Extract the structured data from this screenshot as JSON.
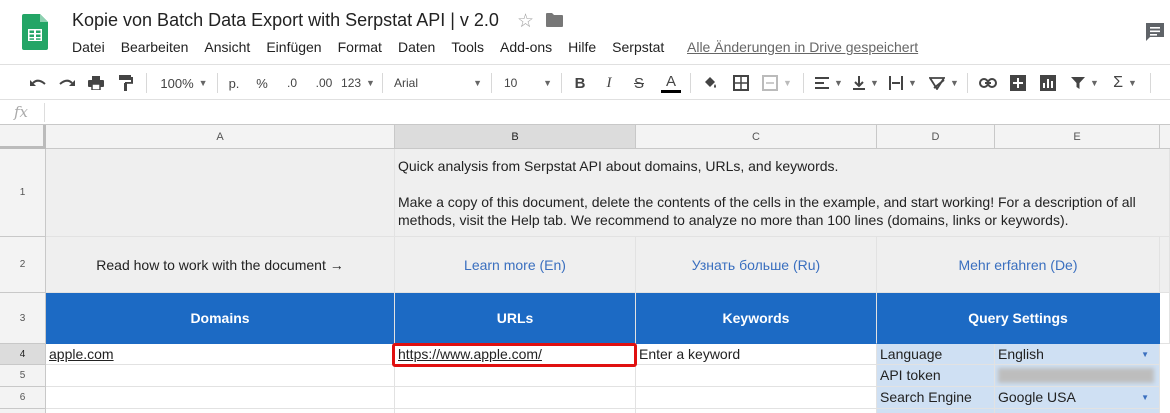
{
  "app": {
    "doc_title": "Kopie von Batch Data Export with Serpstat API |  v 2.0",
    "menu": [
      "Datei",
      "Bearbeiten",
      "Ansicht",
      "Einfügen",
      "Format",
      "Daten",
      "Tools",
      "Add-ons",
      "Hilfe",
      "Serpstat"
    ],
    "saved_status": "Alle Änderungen in Drive gespeichert"
  },
  "toolbar": {
    "zoom": "100%",
    "currency": "p.",
    "percent": "%",
    "dec_decrease": ".0",
    "dec_increase": ".00",
    "more_formats": "123",
    "font": "Arial",
    "font_size": "10"
  },
  "formula_bar": {
    "fx": "fx",
    "value": ""
  },
  "columns": [
    "A",
    "B",
    "C",
    "D",
    "E"
  ],
  "rows": [
    "1",
    "2",
    "3",
    "4",
    "5",
    "6"
  ],
  "cells": {
    "b1_line1": "Quick analysis from Serpstat API about domains, URLs, and keywords.",
    "b1_line2": "Make a copy of this document, delete the contents of the cells in the example, and start working! For a description of all methods, visit the Help tab. We recommend to analyze no more than 100 lines (domains, links or keywords).",
    "a2": "Read how to work with the document →",
    "b2": "Learn more (En)",
    "c2": "Узнать больше (Ru)",
    "de2": "Mehr erfahren (De)",
    "a3": "Domains",
    "b3": "URLs",
    "c3": "Keywords",
    "de3": "Query Settings",
    "a4": "apple.com",
    "b4": "https://www.apple.com/",
    "c4": "Enter a keyword",
    "d4": "Language",
    "e4": "English",
    "d5": "API token",
    "d6": "Search Engine",
    "e6": "Google USA"
  },
  "colors": {
    "header_blue": "#1c6ac4",
    "link_blue": "#3a6fbf",
    "settings_bg": "#cfe0f3",
    "selection_red": "#e01010"
  }
}
